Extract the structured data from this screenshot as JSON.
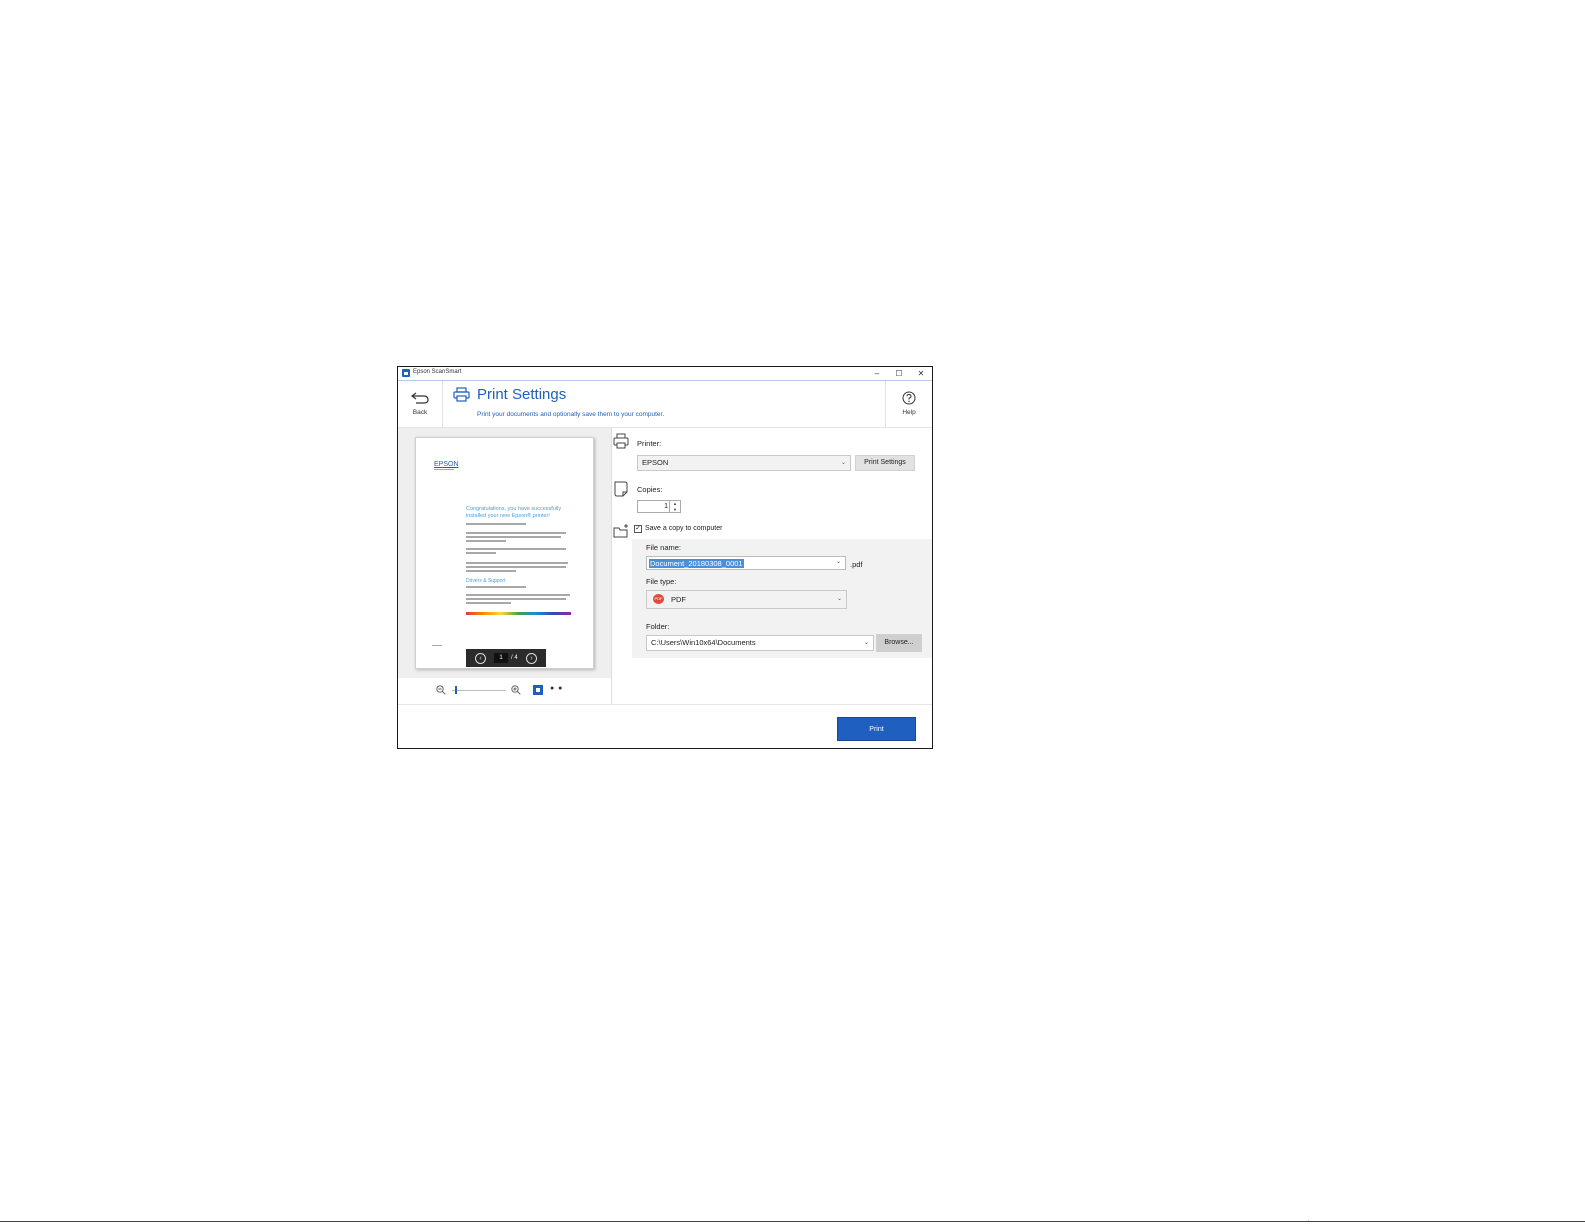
{
  "window": {
    "title": "Epson ScanSmart",
    "controls": {
      "minimize": "–",
      "maximize": "☐",
      "close": "✕"
    }
  },
  "header": {
    "back_label": "Back",
    "title": "Print Settings",
    "subtitle": "Print your documents and optionally save them to your computer.",
    "help_label": "Help"
  },
  "preview": {
    "logo_text": "EPSON",
    "heading": "Congratulations, you have successfully installed your new Epson® printer!",
    "section_heading": "Drivers & Support",
    "current_page": "1",
    "total_pages": "/ 4",
    "zoom_level_fraction": 0.05
  },
  "settings": {
    "printer_label": "Printer:",
    "printer_value": "EPSON",
    "print_settings_button": "Print Settings",
    "copies_label": "Copies:",
    "copies_value": "1",
    "save_copy_label": "Save a copy to computer",
    "save_copy_checked": true,
    "file_name_label": "File name:",
    "file_name_value": "Document_20180308_0001",
    "file_extension": ".pdf",
    "file_type_label": "File type:",
    "file_type_value": "PDF",
    "file_type_icon_text": "PDF",
    "folder_label": "Folder:",
    "folder_value": "C:\\Users\\Win10x64\\Documents",
    "browse_button": "Browse..."
  },
  "footer": {
    "print_button": "Print"
  },
  "colors": {
    "accent": "#1f5fbf",
    "panel": "#f2f2f2",
    "selection": "#4a90d9"
  },
  "icons": [
    "back-arrow-icon",
    "printer-icon",
    "help-icon",
    "zoom-out-icon",
    "zoom-in-icon",
    "fit-page-icon",
    "document-icon",
    "folder-save-icon",
    "pdf-icon",
    "chevron-left-icon",
    "chevron-right-icon"
  ]
}
